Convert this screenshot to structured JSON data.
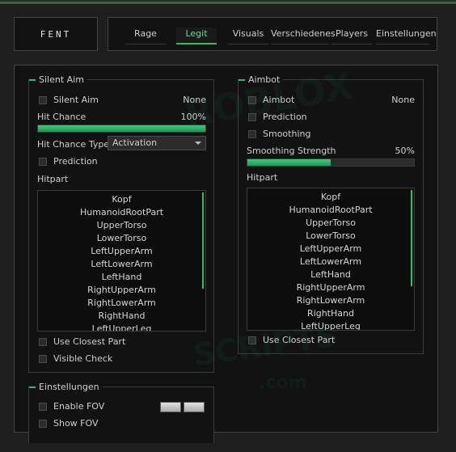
{
  "brand": "FENT",
  "tabs": [
    {
      "label": "Rage",
      "active": false
    },
    {
      "label": "Legit",
      "active": true
    },
    {
      "label": "Visuals",
      "active": false
    },
    {
      "label": "Verschiedenes",
      "active": false
    },
    {
      "label": "Players",
      "active": false
    },
    {
      "label": "Einstellungen",
      "active": false
    }
  ],
  "silent_aim": {
    "title": "Silent Aim",
    "toggle_label": "Silent Aim",
    "toggle_value": "None",
    "hit_chance_label": "Hit Chance",
    "hit_chance_value": "100%",
    "hit_chance_fraction": 1.0,
    "hit_chance_type_label": "Hit Chance Type",
    "hit_chance_type_value": "Activation",
    "prediction_label": "Prediction",
    "hitpart_label": "Hitpart",
    "hitparts": [
      "Kopf",
      "HumanoidRootPart",
      "UpperTorso",
      "LowerTorso",
      "LeftUpperArm",
      "LeftLowerArm",
      "LeftHand",
      "RightUpperArm",
      "RightLowerArm",
      "RightHand",
      "LeftUpperLeg"
    ],
    "use_closest_label": "Use Closest Part",
    "visible_check_label": "Visible Check"
  },
  "aimbot": {
    "title": "Aimbot",
    "toggle_label": "Aimbot",
    "toggle_value": "None",
    "prediction_label": "Prediction",
    "smoothing_label": "Smoothing",
    "smoothing_strength_label": "Smoothing Strength",
    "smoothing_strength_value": "50%",
    "smoothing_strength_fraction": 0.5,
    "hitpart_label": "Hitpart",
    "hitparts": [
      "Kopf",
      "HumanoidRootPart",
      "UpperTorso",
      "LowerTorso",
      "LeftUpperArm",
      "LeftLowerArm",
      "LeftHand",
      "RightUpperArm",
      "RightLowerArm",
      "RightHand",
      "LeftUpperLeg"
    ],
    "use_closest_label": "Use Closest Part"
  },
  "settings": {
    "title": "Einstellungen",
    "enable_fov_label": "Enable FOV",
    "show_fov_label": "Show FOV"
  },
  "watermark": "ROBLOX SCRIPTS .com",
  "colors": {
    "accent": "#22c36b",
    "panel": "#121212",
    "background": "#1e1e1e"
  }
}
